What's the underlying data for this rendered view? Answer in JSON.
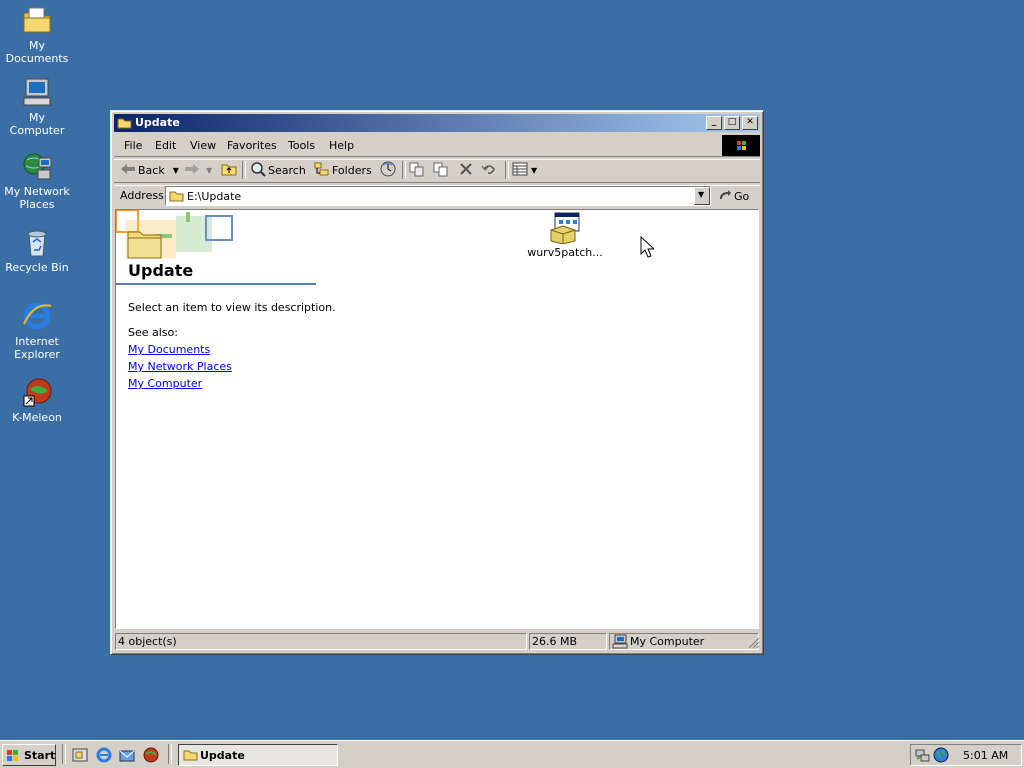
{
  "desktop": {
    "icons": [
      {
        "label": "My Documents"
      },
      {
        "label": "My Computer"
      },
      {
        "label": "My Network Places"
      },
      {
        "label": "Recycle Bin"
      },
      {
        "label": "Internet Explorer"
      },
      {
        "label": "K-Meleon"
      }
    ]
  },
  "window": {
    "title": "Update",
    "menu": [
      "File",
      "Edit",
      "View",
      "Favorites",
      "Tools",
      "Help"
    ],
    "toolbar": {
      "back": "Back",
      "search": "Search",
      "folders": "Folders"
    },
    "address": {
      "label": "Address",
      "value": "E:\\Update",
      "go": "Go"
    },
    "webview": {
      "heading": "Update",
      "description": "Select an item to view its description.",
      "see_also": "See also:",
      "links": [
        "My Documents",
        "My Network Places",
        "My Computer"
      ]
    },
    "files": [
      {
        "name": "wurv5patch..."
      }
    ],
    "status": {
      "objects": "4 object(s)",
      "size": "26.6 MB",
      "zone": "My Computer"
    }
  },
  "taskbar": {
    "start": "Start",
    "task": "Update",
    "clock": "5:01 AM"
  },
  "colors": {
    "desktop": "#3a6ea5",
    "title_active": "#0a246a",
    "title_gradient_end": "#a6caf0",
    "face": "#d4d0c8"
  }
}
